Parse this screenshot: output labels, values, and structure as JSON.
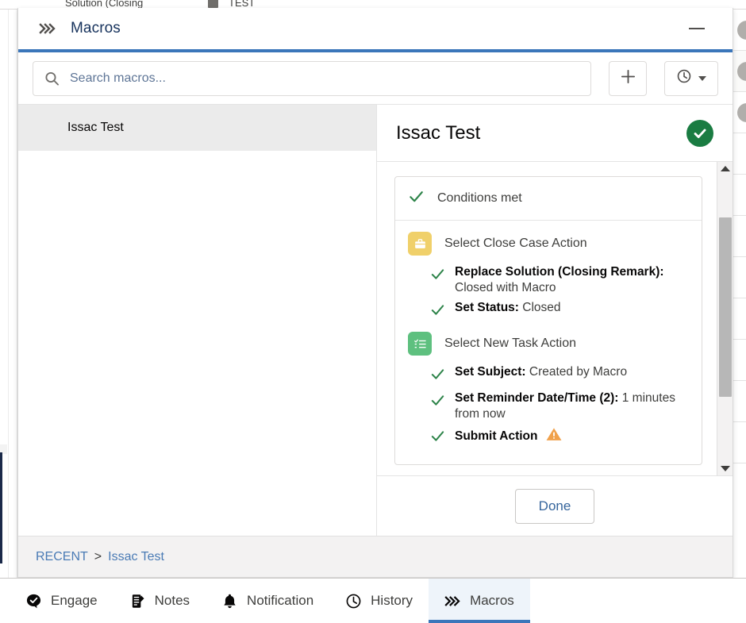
{
  "background": {
    "cut_labels": [
      "Solution (Closing",
      "TEST"
    ],
    "grid_icon": "bar-chart-icon",
    "right_rows": 11
  },
  "panel": {
    "header": {
      "icon": "triple-chevron-icon",
      "title": "Macros",
      "minimize_label": "",
      "minimize_icon": "minimize-icon",
      "accent_color": "#3b76ba"
    },
    "search": {
      "icon": "search-icon",
      "placeholder": "Search macros...",
      "value": "",
      "add_button_icon": "plus-icon",
      "recent_button_icon": "clock-icon",
      "recent_button_caret": "chevron-down-icon"
    },
    "list": {
      "items": [
        {
          "label": "Issac Test",
          "selected": true
        }
      ]
    },
    "detail": {
      "title": "Issac Test",
      "status_icon": "check-circle-icon",
      "status_color": "#1a7c42",
      "conditions": {
        "icon": "check-icon",
        "label": "Conditions met"
      },
      "actions": [
        {
          "badge_icon": "briefcase-icon",
          "badge_color": "#f0d06a",
          "label": "Select Close Case Action",
          "steps": [
            {
              "icon": "check-icon",
              "name": "Replace Solution (Closing Remark):",
              "value": "Closed with Macro",
              "warning": false
            },
            {
              "icon": "check-icon",
              "name": "Set Status:",
              "value": "Closed",
              "warning": false
            }
          ]
        },
        {
          "badge_icon": "task-list-icon",
          "badge_color": "#5ec07f",
          "label": "Select New Task Action",
          "steps": [
            {
              "icon": "check-icon",
              "name": "Set Subject:",
              "value": "Created by Macro",
              "warning": false
            },
            {
              "icon": "check-icon",
              "name": "Set Reminder Date/Time (2):",
              "value": "1 minutes from now",
              "warning": false
            },
            {
              "icon": "check-icon",
              "name": "Submit Action",
              "value": "",
              "warning": true,
              "warning_icon": "warning-triangle-icon"
            }
          ]
        }
      ],
      "scrollbar": {
        "up_icon": "triangle-up-icon",
        "down_icon": "triangle-down-icon"
      },
      "done_label": "Done"
    },
    "footer": {
      "breadcrumb": [
        {
          "label": "RECENT",
          "link": true
        },
        {
          "label": "Issac Test",
          "link": true
        }
      ],
      "separator": ">"
    }
  },
  "utility_bar": {
    "items": [
      {
        "label": "Engage",
        "icon": "engage-check-badge-icon",
        "active": false
      },
      {
        "label": "Notes",
        "icon": "notes-icon",
        "active": false
      },
      {
        "label": "Notification",
        "icon": "bell-icon",
        "active": false
      },
      {
        "label": "History",
        "icon": "clock-icon",
        "active": false
      },
      {
        "label": "Macros",
        "icon": "triple-chevron-icon",
        "active": true
      }
    ],
    "active_accent": "#3b76ba"
  }
}
